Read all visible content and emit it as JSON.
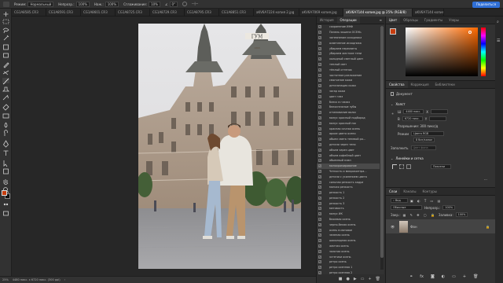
{
  "options_bar": {
    "mode_label": "Режим:",
    "mode_value": "Нормальный",
    "opacity_label": "Непрозр.:",
    "opacity_value": "100%",
    "flow_label": "Наж.:",
    "flow_value": "100%",
    "smoothing_label": "Сглаживание:",
    "smoothing_value": "10%",
    "angle_value": "0°",
    "share_label": "Поделиться"
  },
  "doc_tabs": [
    {
      "label": "CG1A8585.CR3"
    },
    {
      "label": "CG1A8591.CR3"
    },
    {
      "label": "CG1A8601.CR3"
    },
    {
      "label": "CG1A8725.CR3"
    },
    {
      "label": "CG1A8729.CR3"
    },
    {
      "label": "CG1A8795.CR3"
    },
    {
      "label": "CG1A8851.CR3"
    },
    {
      "label": "aKV6A7224 копия 2.jpg"
    },
    {
      "label": "aKV6A7069 копия.jpg"
    },
    {
      "label": "aKV6A7144 копия.jpg @ 25% (RGB/8)"
    },
    {
      "label": "aKV6A7144 копия"
    }
  ],
  "photo": {
    "sign_text": "ГУМ",
    "year_text": "1893"
  },
  "status_bar": {
    "zoom": "25%",
    "doc_size": "4480 пикс. x 6720 пикс. (300 ppi)"
  },
  "history_panel": {
    "tabs": [
      "История",
      "Операции"
    ],
    "actions": [
      "сохранение ИНФ",
      "Панель экшена ОСЕНЬ",
      "затемнение исходника",
      "осветление исходника",
      "убираем пересветы",
      "убираем жесткие тени",
      "холодный светлый цвет",
      "теплый свет",
      "тёплый оттенок",
      "частотное разложение",
      "смягчение кожи",
      "детализация кожи",
      "загар кожи",
      "цвет глаз",
      "блеск в глазах",
      "белоснежные зубы",
      "отчеливание волос",
      "минус красный подбород",
      "минус красный нос",
      "красная сочная осень",
      "яркие цвета осени",
      "обьем света теневой ро...",
      "детали через тени",
      "объем через цвет",
      "объем кофейный цвет",
      "обьемный план",
      "монохромирование",
      "Четкость и микроконтра...",
      "детали с усилением цвета",
      "сильная резкость кадра",
      "мягкая резкость",
      "резкость 1",
      "резкость 2",
      "резкость 3",
      "матовость",
      "минус ИК",
      "бежевая осень",
      "черно-белая осень",
      "осень в матовое",
      "зеленая осень",
      "шоколадная осень",
      "желтая осень",
      "золотая осень",
      "эстетики осень",
      "ретро осень",
      "ретро осенняя 1",
      "ретро осенняя 2",
      "темная осень"
    ],
    "selected_index": 26
  },
  "color_panel": {
    "tabs": [
      "Цвет",
      "Образцы",
      "Градиенты",
      "Узоры"
    ],
    "active_tab": 0,
    "colors": {
      "foreground": "#c73d0e",
      "background": "#111111",
      "hue": "#ff6a00"
    }
  },
  "properties_panel": {
    "tabs": [
      "Свойства",
      "Коррекция",
      "Библиотеки"
    ],
    "doc_label": "Документ",
    "canvas_heading": "Холст",
    "width_label": "Ш",
    "width_value": "4480 пикс.",
    "height_label": "В",
    "height_value": "6720 пикс.",
    "x_label": "X",
    "y_label": "Y",
    "resolution_label": "Разрешение: 300 пикс/д",
    "mode_label": "Режим",
    "mode_value": "Цвета RGB",
    "bits_value": "8 бит/канал",
    "fill_label": "Заполнить",
    "fill_value": "Цвет фона",
    "guides_heading": "Линейки и сетка",
    "units_value": "Пиксели"
  },
  "layers_panel": {
    "tabs": [
      "Слои",
      "Каналы",
      "Контуры"
    ],
    "kind_label": "Вид",
    "blend_label": "Обычные",
    "opacity_label": "Непрозр.:",
    "opacity_value": "100%",
    "lock_label": "Закр.:",
    "fill_label": "Заливка:",
    "fill_value": "100%",
    "layers": [
      {
        "name": "Фон"
      }
    ]
  }
}
